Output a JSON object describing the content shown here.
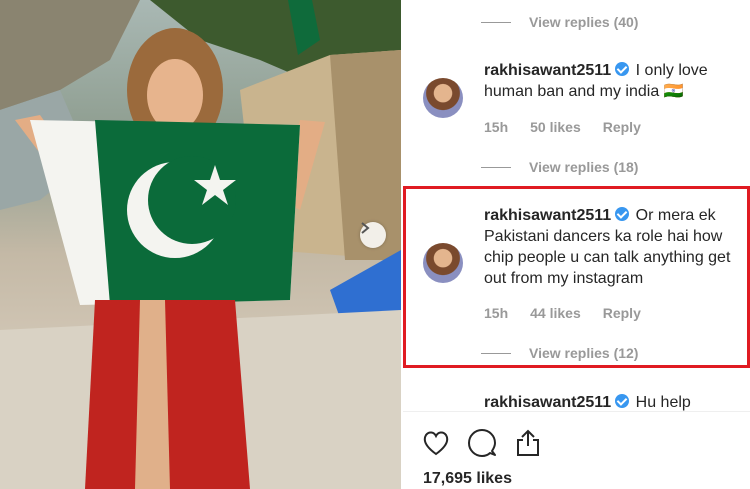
{
  "post_image": {
    "flag_colors": {
      "green": "#0b6b3a",
      "white": "#f4f4f0"
    },
    "nav_arrow_icon": "chevron-right-icon"
  },
  "comments": {
    "view_replies_1": "View replies (40)",
    "comment_1": {
      "username": "rakhisawant2511",
      "text": "I only love human ban and my india 🇮🇳",
      "time": "15h",
      "likes": "50 likes",
      "reply": "Reply"
    },
    "view_replies_2": "View replies (18)",
    "comment_2": {
      "username": "rakhisawant2511",
      "text": "Or mera ek Pakistani dancers ka role hai how chip people u can talk anything get out from my instagram",
      "time": "15h",
      "likes": "44 likes",
      "reply": "Reply"
    },
    "view_replies_3": "View replies (12)",
    "comment_3": {
      "username": "rakhisawant2511",
      "text": "Hu help"
    }
  },
  "actions": {
    "icons": [
      "heart-icon",
      "comment-icon",
      "share-icon"
    ],
    "likes_count": "17,695 likes"
  },
  "highlight_color": "#e01b22"
}
